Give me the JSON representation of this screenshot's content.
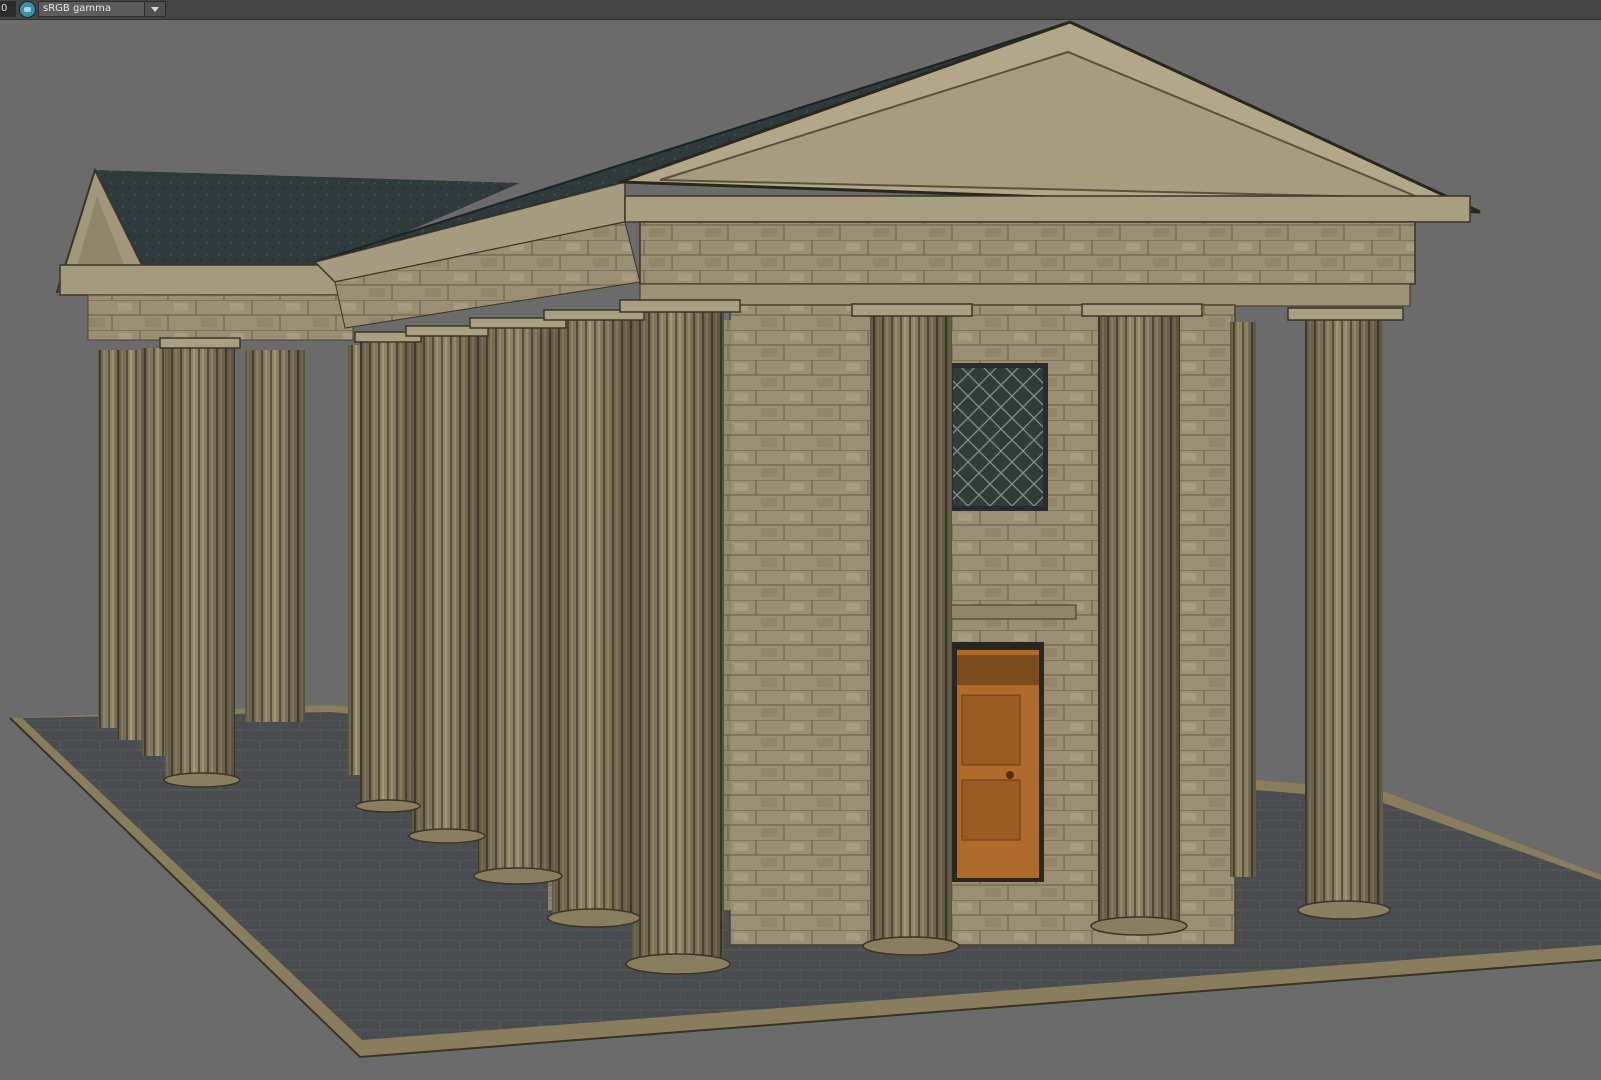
{
  "toolbar": {
    "field_value": "0",
    "color_management_icon": "color-management-icon",
    "colorspace": {
      "selected": "sRGB gamma",
      "dropdown_icon": "chevron-down-icon"
    }
  },
  "viewport": {
    "background_color": "#6b6b6b",
    "scene_colors": {
      "stone": "#9e9377",
      "roof": "#2e3a3c",
      "floor": "#4a4a4c",
      "door": "#b06a2a",
      "window": "#2e3a36"
    }
  }
}
